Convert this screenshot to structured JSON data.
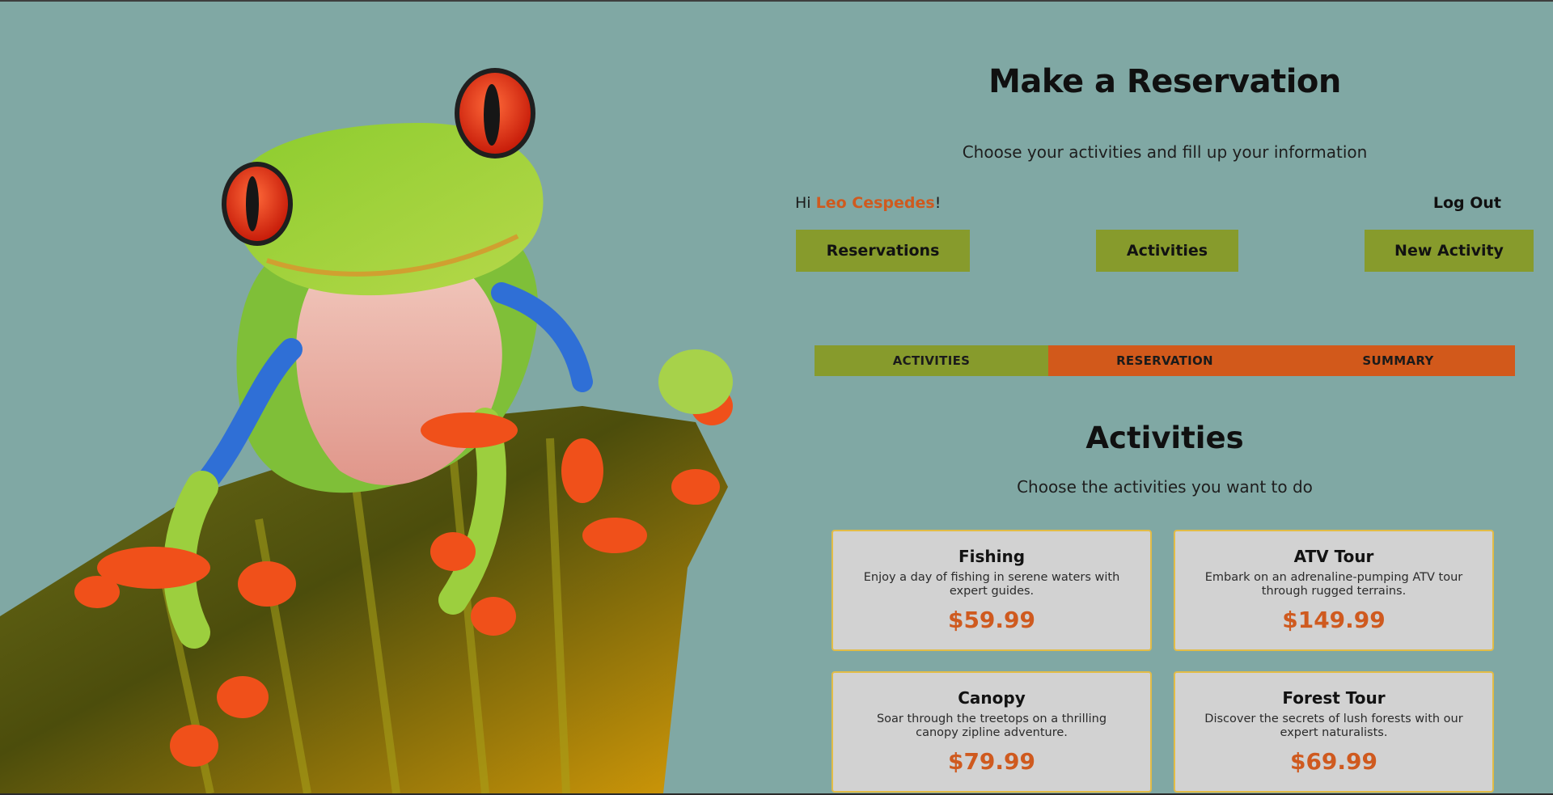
{
  "header": {
    "title": "Make a Reservation",
    "subtitle": "Choose your activities and fill up your information"
  },
  "user": {
    "greeting_prefix": "Hi ",
    "name": "Leo Cespedes",
    "greeting_suffix": "!",
    "logout_label": "Log Out"
  },
  "nav": {
    "reservations_label": "Reservations",
    "activities_label": "Activities",
    "new_activity_label": "New Activity"
  },
  "steps": [
    {
      "label": "ACTIVITIES",
      "active": true
    },
    {
      "label": "RESERVATION",
      "active": false
    },
    {
      "label": "SUMMARY",
      "active": false
    }
  ],
  "activities_section": {
    "title": "Activities",
    "subtitle": "Choose the activities you want to do"
  },
  "activities": [
    {
      "name": "Fishing",
      "description": "Enjoy a day of fishing in serene waters with expert guides.",
      "price": "$59.99"
    },
    {
      "name": "ATV Tour",
      "description": "Embark on an adrenaline-pumping ATV tour through rugged terrains.",
      "price": "$149.99"
    },
    {
      "name": "Canopy",
      "description": "Soar through the treetops on a thrilling canopy zipline adventure.",
      "price": "$79.99"
    },
    {
      "name": "Forest Tour",
      "description": "Discover the secrets of lush forests with our expert naturalists.",
      "price": "$69.99"
    }
  ],
  "colors": {
    "background": "#80a8a4",
    "olive_button": "#879b2c",
    "orange_accent": "#d2591b",
    "card_background": "#d2d2d2",
    "card_border": "#e2bc46"
  },
  "hero_image": {
    "icon": "tree-frog-illustration"
  }
}
